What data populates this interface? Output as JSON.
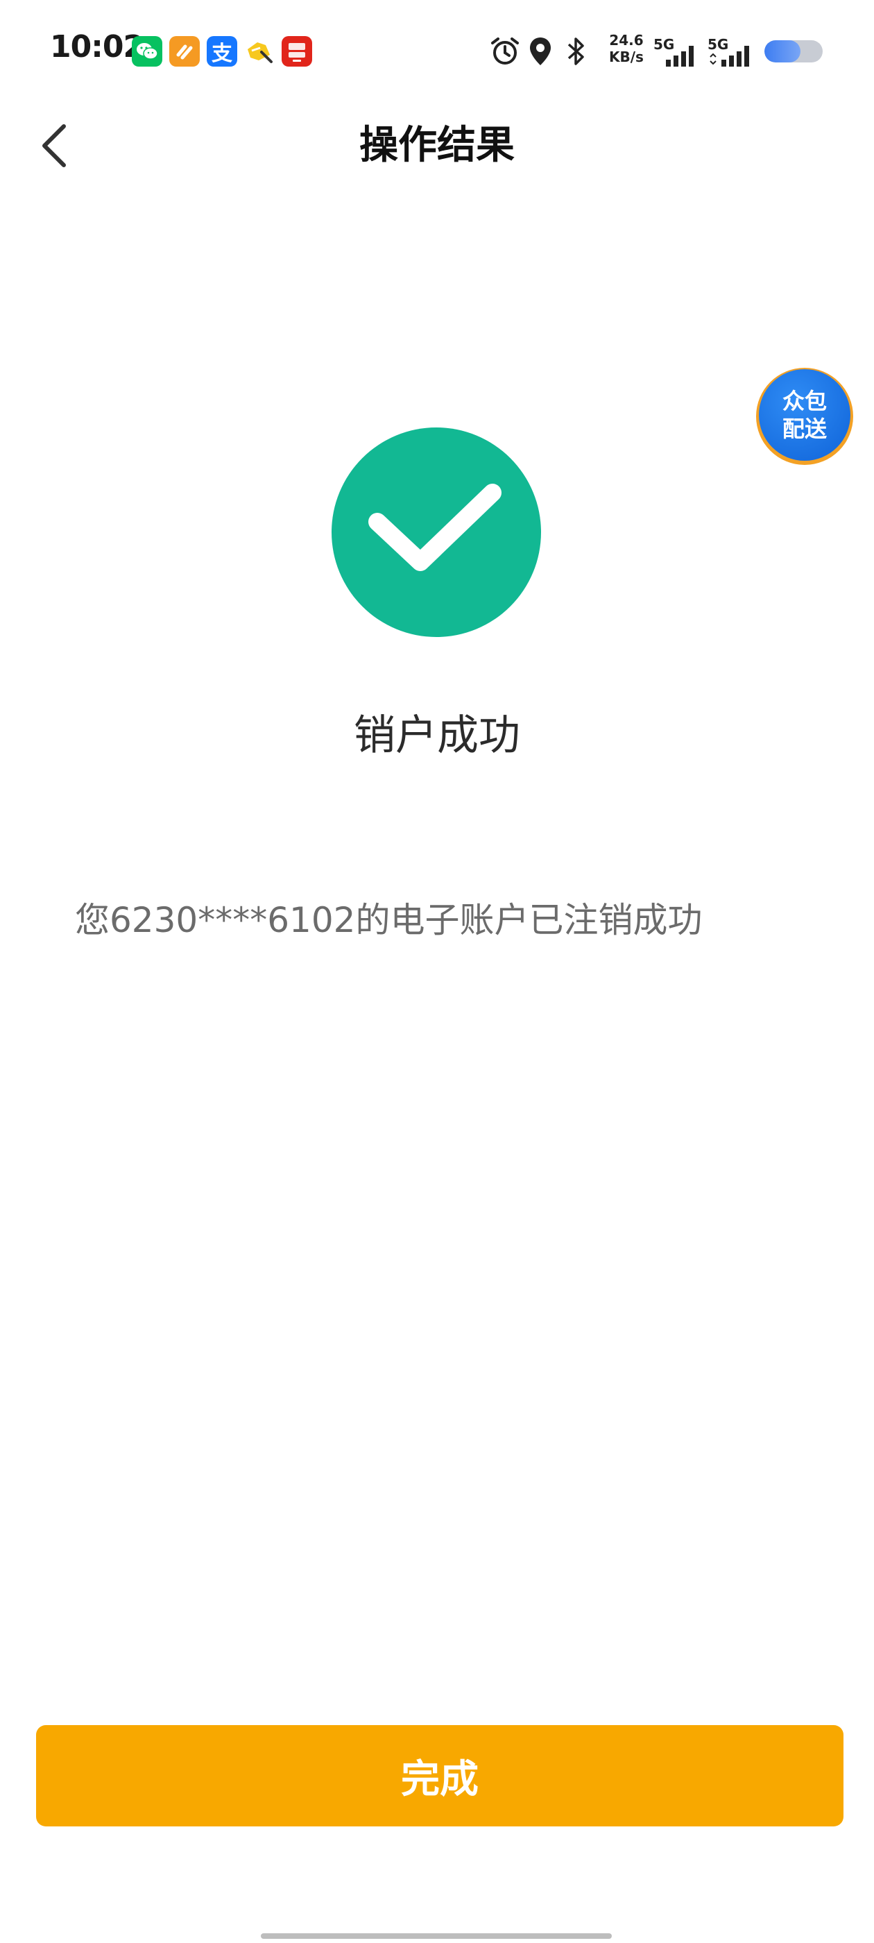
{
  "status_bar": {
    "time": "10:02",
    "net_speed_value": "24.6",
    "net_speed_unit": "KB/s",
    "signal1_label": "5G",
    "signal2_label": "5G",
    "battery_level": 0.62,
    "apps": [
      {
        "icon": "wechat-icon",
        "color": "#07c160"
      },
      {
        "icon": "orange-app-icon",
        "color": "#f59a23"
      },
      {
        "icon": "alipay-icon",
        "color": "#1677ff",
        "glyph": "支"
      },
      {
        "icon": "pencil-app-icon",
        "color": "#f7c81e"
      },
      {
        "icon": "jd-seckill-icon",
        "color": "#e1251b",
        "text": "京东秒送"
      }
    ]
  },
  "nav": {
    "title": "操作结果"
  },
  "float_badge": {
    "line1": "众包",
    "line2": "配送"
  },
  "result": {
    "status": "success",
    "title": "销户成功",
    "message": "您6230****6102的电子账户已注销成功"
  },
  "actions": {
    "done_label": "完成"
  },
  "colors": {
    "success": "#12b893",
    "primary_button": "#f8a800",
    "badge_blue": "#1a74ea",
    "badge_ring": "#f3a125"
  }
}
